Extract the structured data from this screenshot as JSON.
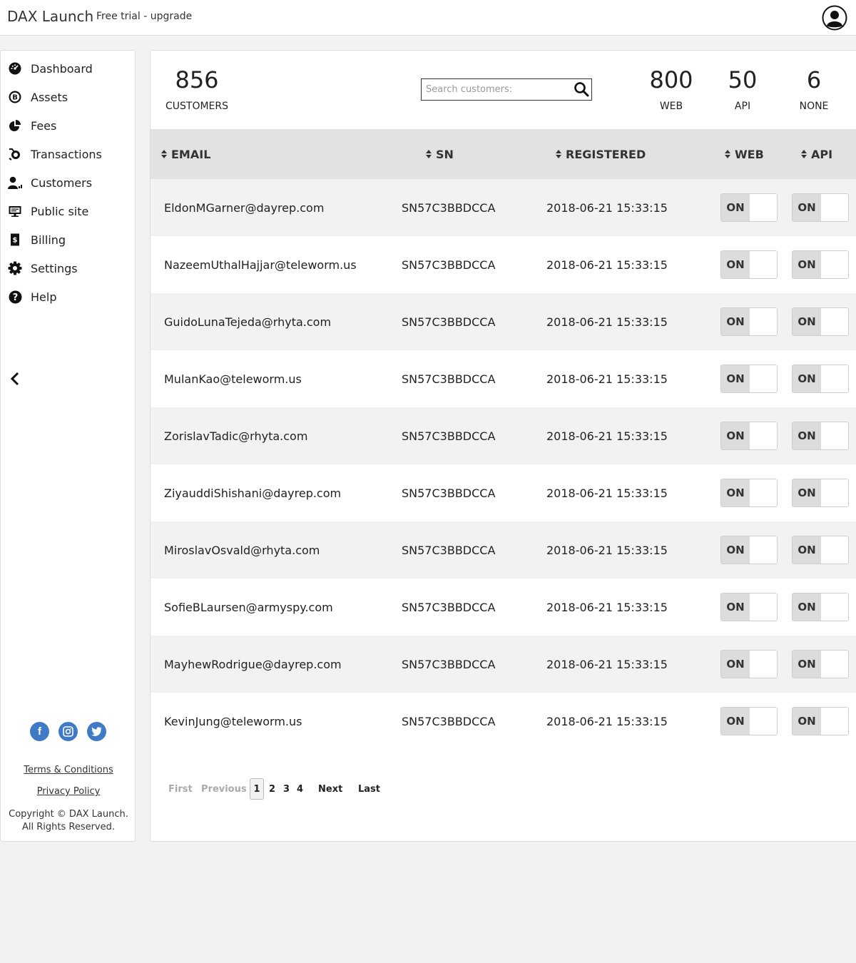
{
  "header": {
    "brand": "DAX Launch",
    "trial": "Free trial - upgrade",
    "avatar_icon": "user-circle-icon"
  },
  "sidebar": {
    "items": [
      {
        "label": "Dashboard",
        "icon": "dashboard-icon"
      },
      {
        "label": "Assets",
        "icon": "bitcoin-icon"
      },
      {
        "label": "Fees",
        "icon": "pie-chart-icon"
      },
      {
        "label": "Transactions",
        "icon": "transactions-icon"
      },
      {
        "label": "Customers",
        "icon": "user-icon"
      },
      {
        "label": "Public site",
        "icon": "monitor-icon"
      },
      {
        "label": "Billing",
        "icon": "invoice-icon"
      },
      {
        "label": "Settings",
        "icon": "gear-icon"
      },
      {
        "label": "Help",
        "icon": "question-icon"
      }
    ],
    "collapse_icon": "chevron-left-icon",
    "socials": [
      "facebook-icon",
      "instagram-icon",
      "twitter-icon"
    ],
    "terms": "Terms & Conditions",
    "privacy": "Privacy Policy",
    "copyright_line1": "Copyright © DAX Launch.",
    "copyright_line2": "All Rights Reserved."
  },
  "stats": {
    "customers": {
      "value": "856",
      "label": "CUSTOMERS"
    },
    "web": {
      "value": "800",
      "label": "WEB"
    },
    "api": {
      "value": "50",
      "label": "API"
    },
    "none": {
      "value": "6",
      "label": "NONE"
    }
  },
  "search": {
    "placeholder": "Search customers:",
    "icon": "search-icon"
  },
  "table": {
    "columns": [
      "EMAIL",
      "SN",
      "REGISTERED",
      "WEB",
      "API"
    ],
    "rows": [
      {
        "email": "EldonMGarner@dayrep.com",
        "sn": "SN57C3BBDCCA",
        "registered": "2018-06-21 15:33:15",
        "web": "ON",
        "api": "ON"
      },
      {
        "email": "NazeemUthalHajjar@teleworm.us",
        "sn": "SN57C3BBDCCA",
        "registered": "2018-06-21 15:33:15",
        "web": "ON",
        "api": "ON"
      },
      {
        "email": "GuidoLunaTejeda@rhyta.com",
        "sn": "SN57C3BBDCCA",
        "registered": "2018-06-21 15:33:15",
        "web": "ON",
        "api": "ON"
      },
      {
        "email": "MulanKao@teleworm.us",
        "sn": "SN57C3BBDCCA",
        "registered": "2018-06-21 15:33:15",
        "web": "ON",
        "api": "ON"
      },
      {
        "email": "ZorislavTadic@rhyta.com",
        "sn": "SN57C3BBDCCA",
        "registered": "2018-06-21 15:33:15",
        "web": "ON",
        "api": "ON"
      },
      {
        "email": "ZiyauddiShishani@dayrep.com",
        "sn": "SN57C3BBDCCA",
        "registered": "2018-06-21 15:33:15",
        "web": "ON",
        "api": "ON"
      },
      {
        "email": "MiroslavOsvald@rhyta.com",
        "sn": "SN57C3BBDCCA",
        "registered": "2018-06-21 15:33:15",
        "web": "ON",
        "api": "ON"
      },
      {
        "email": "SofieBLaursen@armyspy.com",
        "sn": "SN57C3BBDCCA",
        "registered": "2018-06-21 15:33:15",
        "web": "ON",
        "api": "ON"
      },
      {
        "email": "MayhewRodrigue@dayrep.com",
        "sn": "SN57C3BBDCCA",
        "registered": "2018-06-21 15:33:15",
        "web": "ON",
        "api": "ON"
      },
      {
        "email": "KevinJung@teleworm.us",
        "sn": "SN57C3BBDCCA",
        "registered": "2018-06-21 15:33:15",
        "web": "ON",
        "api": "ON"
      }
    ]
  },
  "pagination": {
    "first": "First",
    "previous": "Previous",
    "pages": [
      "1",
      "2",
      "3",
      "4"
    ],
    "current": "1",
    "next": "Next",
    "last": "Last"
  }
}
